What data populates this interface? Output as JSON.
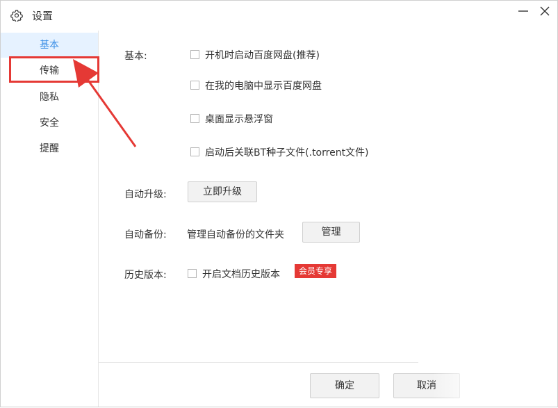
{
  "window": {
    "title": "设置",
    "icons": {
      "settings": "gear-icon",
      "minimize": "minimize-icon",
      "close": "close-icon"
    }
  },
  "sidebar": {
    "items": [
      {
        "label": "基本",
        "active": true
      },
      {
        "label": "传输",
        "active": false
      },
      {
        "label": "隐私",
        "active": false
      },
      {
        "label": "安全",
        "active": false
      },
      {
        "label": "提醒",
        "active": false
      }
    ]
  },
  "basic": {
    "label": "基本:",
    "options": [
      {
        "label": "开机时启动百度网盘(推荐)",
        "checked": false
      },
      {
        "label": "在我的电脑中显示百度网盘",
        "checked": false
      },
      {
        "label": "桌面显示悬浮窗",
        "checked": false
      },
      {
        "label": "启动后关联BT种子文件(.torrent文件)",
        "checked": false
      }
    ]
  },
  "auto_upgrade": {
    "label": "自动升级:",
    "button": "立即升级"
  },
  "auto_backup": {
    "label": "自动备份:",
    "description": "管理自动备份的文件夹",
    "button": "管理"
  },
  "history": {
    "label": "历史版本:",
    "option": "开启文档历史版本",
    "checked": false,
    "badge": "会员专享"
  },
  "footer": {
    "ok": "确定",
    "cancel": "取消"
  },
  "colors": {
    "accent": "#3b8fe6",
    "active_bg": "#e6f2ff",
    "highlight": "#e53935",
    "badge_bg": "#e53935"
  }
}
